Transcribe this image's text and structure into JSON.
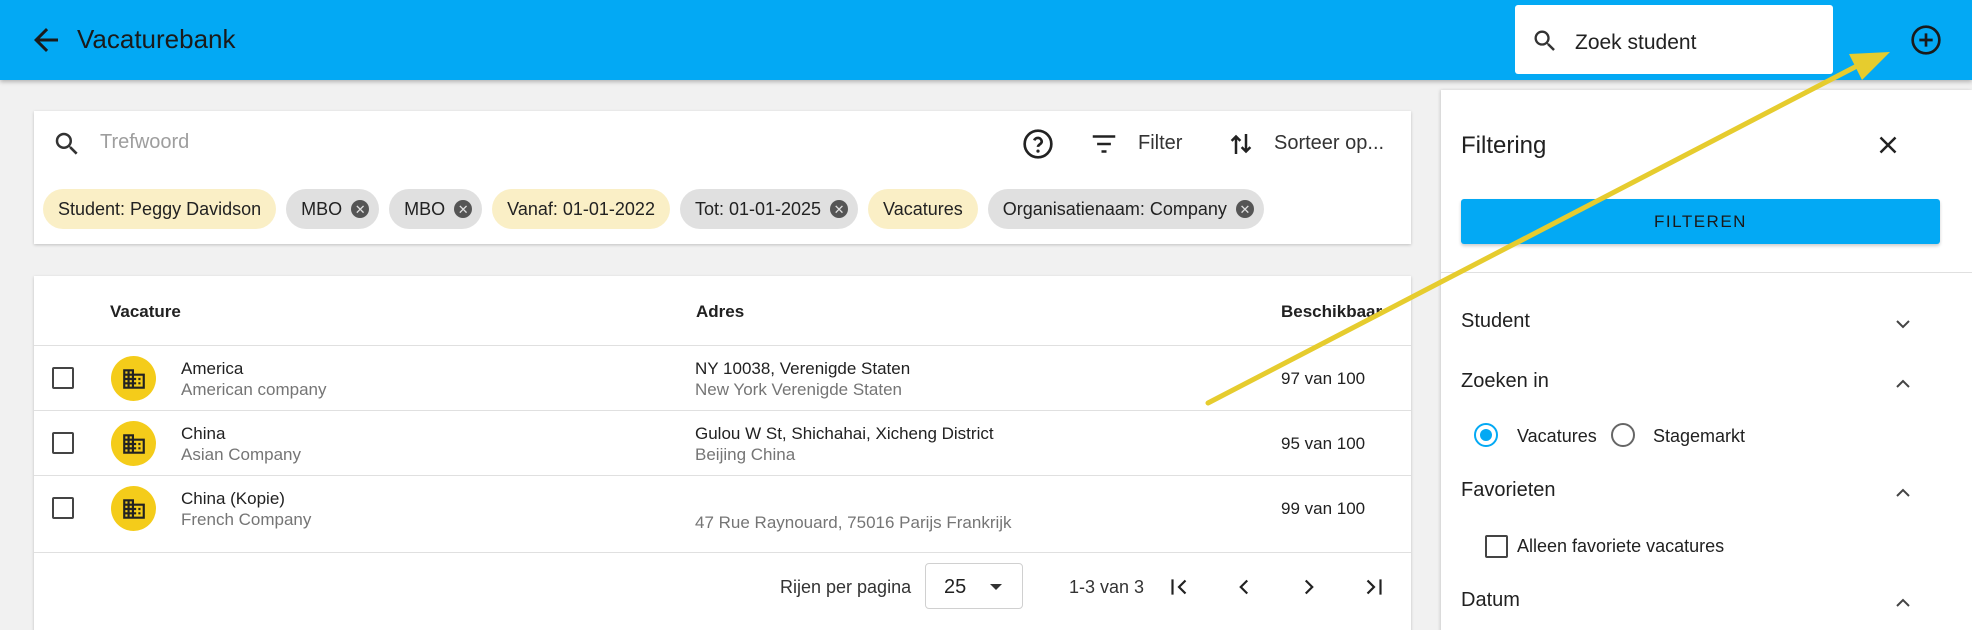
{
  "appbar": {
    "title": "Vacaturebank",
    "search_value": "Zoek student",
    "back_icon": "arrow-back-icon",
    "add_icon": "plus-circle-icon"
  },
  "searchcard": {
    "keyword_placeholder": "Trefwoord",
    "filter_label": "Filter",
    "sort_label": "Sorteer op...",
    "chips": [
      {
        "label": "Student: Peggy Davidson",
        "removable": false
      },
      {
        "label": "MBO",
        "removable": true
      },
      {
        "label": "MBO",
        "removable": true
      },
      {
        "label": "Vanaf: 01-01-2022",
        "removable": false
      },
      {
        "label": "Tot: 01-01-2025",
        "removable": true
      },
      {
        "label": "Vacatures",
        "removable": false
      },
      {
        "label": "Organisatienaam: Company",
        "removable": true
      }
    ]
  },
  "table": {
    "headers": {
      "vacature": "Vacature",
      "adres": "Adres",
      "beschikbaar": "Beschikbaar"
    },
    "rows": [
      {
        "name": "America",
        "company": "American company",
        "address1": "NY 10038, Verenigde Staten",
        "address2": "New York Verenigde Staten",
        "available": "97 van 100"
      },
      {
        "name": "China",
        "company": "Asian Company",
        "address1": "Gulou W St, Shichahai, Xicheng District",
        "address2": "Beijing China",
        "available": "95 van 100"
      },
      {
        "name": "China (Kopie)",
        "company": "French Company",
        "address1": "",
        "address2": "47 Rue Raynouard, 75016 Parijs Frankrijk",
        "available": "99 van 100"
      }
    ],
    "pager": {
      "rows_per_page_label": "Rijen per pagina",
      "rows_per_page": "25",
      "range": "1-3 van 3"
    }
  },
  "panel": {
    "title": "Filtering",
    "filter_button": "FILTEREN",
    "sections": {
      "student": "Student",
      "zoeken_in": "Zoeken in",
      "favorieten": "Favorieten",
      "datum": "Datum"
    },
    "radio_vacatures": "Vacatures",
    "radio_stagemarkt": "Stagemarkt",
    "favorites_checkbox": "Alleen favoriete vacatures"
  },
  "colors": {
    "primary": "#03a9f4",
    "chip_yellow": "#faefc6",
    "chip_grey": "#e0e0e0",
    "avatar": "#f4cc1a",
    "annotation_arrow": "#e6cc2e"
  }
}
